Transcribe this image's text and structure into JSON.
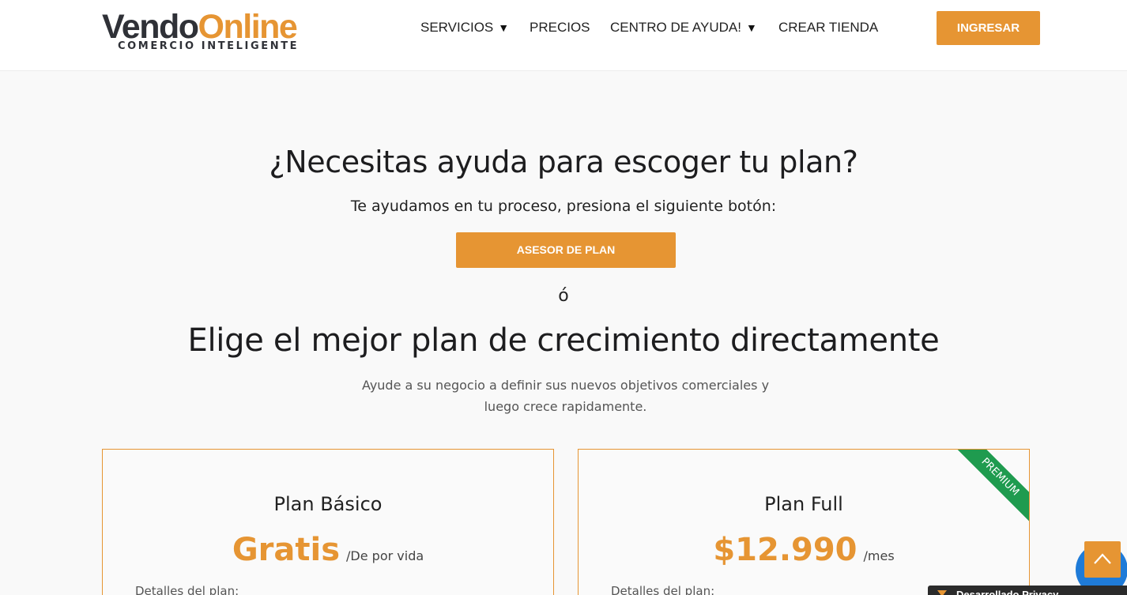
{
  "header": {
    "logo": {
      "part1": "Vendo",
      "part2": "Online",
      "tagline": "COMERCIO INTELIGENTE"
    },
    "nav": [
      {
        "label": "SERVICIOS",
        "has_dropdown": true
      },
      {
        "label": "PRECIOS",
        "has_dropdown": false
      },
      {
        "label": "CENTRO DE AYUDA!",
        "has_dropdown": true
      },
      {
        "label": "CREAR TIENDA",
        "has_dropdown": false
      }
    ],
    "caret": "▼",
    "login_button": "INGRESAR"
  },
  "hero": {
    "title": "¿Necesitas ayuda para escoger tu plan?",
    "subtitle": "Te ayudamos en tu proceso, presiona el siguiente botón:",
    "advisor_button": "ASESOR DE PLAN",
    "or": "ó",
    "title2": "Elige el mejor plan de crecimiento directamente",
    "description": "Ayude a su negocio a definir sus nuevos objetivos comerciales y luego crece rapidamente."
  },
  "plans": [
    {
      "name": "Plan Básico",
      "price": "Gratis",
      "period": "/De por vida",
      "details_label": "Detalles del plan:",
      "badge": ""
    },
    {
      "name": "Plan Full",
      "price": "$12.990",
      "period": "/mes",
      "details_label": "Detalles del plan:",
      "badge": "PREMIUM"
    }
  ],
  "cookie_bar": {
    "text": "Desarrollado Privacy"
  },
  "colors": {
    "accent": "#e69533",
    "premium": "#1f9b4f",
    "chat": "#1f7bd8",
    "logo_dark": "#2f3137"
  },
  "icons": {
    "scroll_top": "chevron-up-icon",
    "chat": "chat-icon"
  }
}
